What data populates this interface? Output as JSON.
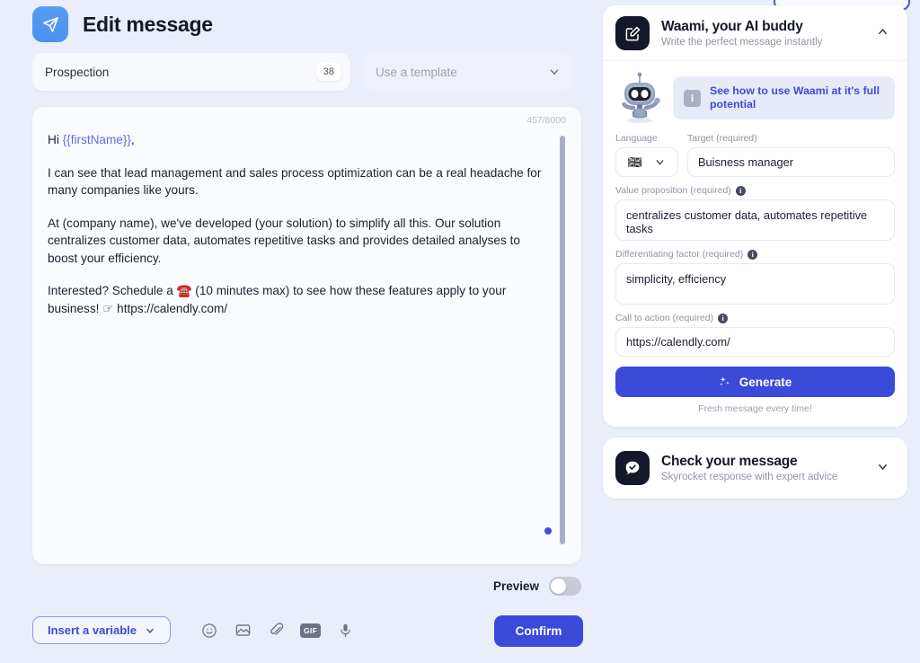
{
  "header": {
    "title": "Edit message",
    "icon": "send-plane-icon"
  },
  "name_field": {
    "value": "Prospection",
    "counter": "38"
  },
  "template_select": {
    "placeholder": "Use a template",
    "icon": "chevron-down-icon"
  },
  "editor": {
    "char_count": "457/8000",
    "paragraphs": [
      {
        "prefix": "Hi ",
        "variable": "{{firstName}}",
        "suffix": ","
      },
      {
        "text": "I can see that lead management and sales process optimization can be a real headache for many companies like yours."
      },
      {
        "text": "At (company name), we've developed (your solution) to simplify all this. Our solution centralizes customer data, automates repetitive tasks and provides detailed analyses to boost your efficiency."
      },
      {
        "text": "Interested? Schedule a ☎️ (10 minutes max) to see how these features apply to your business! ☞ https://calendly.com/"
      }
    ]
  },
  "preview": {
    "label": "Preview",
    "enabled": false
  },
  "bottom_toolbar": {
    "insert_variable_label": "Insert a variable",
    "icons": [
      "emoji-icon",
      "image-icon",
      "attachment-icon",
      "gif-icon",
      "microphone-icon"
    ],
    "gif_label": "GIF"
  },
  "confirm_button": {
    "label": "Confirm"
  },
  "waami_card": {
    "title": "Waami, your AI buddy",
    "subtitle": "Write the perfect message instantly",
    "icon": "compose-edit-icon",
    "chevron": "chevron-up-icon",
    "expanded": true,
    "promo": {
      "text": "See how to use Waami at it's full potential",
      "info_icon": "info-icon",
      "mascot": "robot-mascot-icon"
    },
    "fields": {
      "language": {
        "label": "Language",
        "flag": "🇬🇧",
        "chevron": "chevron-down-icon"
      },
      "target": {
        "label": "Target (required)",
        "value": "Buisness manager"
      },
      "value_proposition": {
        "label": "Value proposition (required)",
        "value": "centralizes customer data, automates repetitive tasks",
        "has_info": true
      },
      "differentiating_factor": {
        "label": "Differentiating factor (required)",
        "value": "simplicity, efficiency",
        "has_info": true
      },
      "call_to_action": {
        "label": "Call to action (required)",
        "value": "https://calendly.com/",
        "has_info": true
      }
    },
    "generate_button": {
      "label": "Generate",
      "icon": "sparkles-icon"
    },
    "generate_note": "Fresh message every time!"
  },
  "check_card": {
    "title": "Check your message",
    "subtitle": "Skyrocket response with expert advice",
    "icon": "chat-check-icon",
    "chevron": "chevron-down-icon",
    "expanded": false
  },
  "colors": {
    "background": "#eaeefb",
    "accent_blue": "#3a4ad9",
    "header_badge": "#4a90ef",
    "dark_square": "#15182a",
    "muted_text": "#8f95a6"
  }
}
